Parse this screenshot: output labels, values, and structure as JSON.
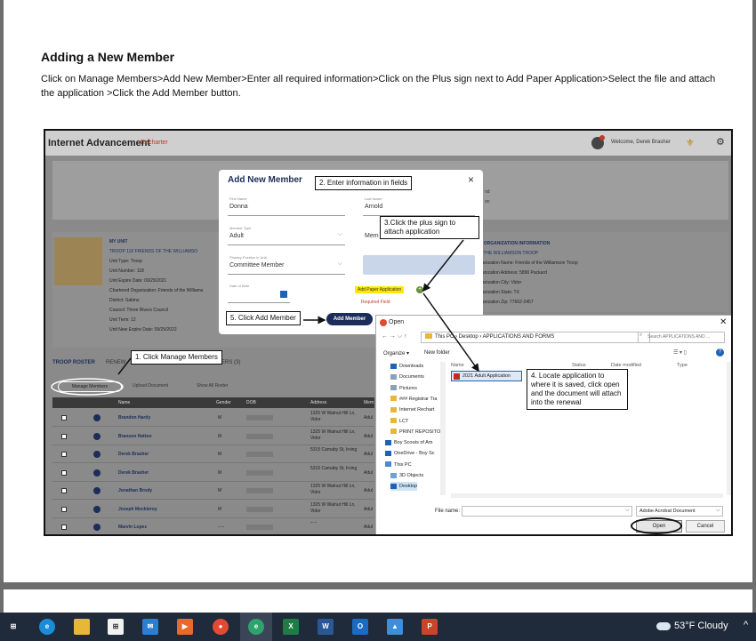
{
  "document": {
    "heading": "Adding a New Member",
    "instructions": "Click on Manage Members>Add New Member>Enter all required information>Click on the Plus sign next to Add Paper Application>Select the file and attach the application >Click the Add Member button."
  },
  "app": {
    "title": "Internet Advancement",
    "mode": "Recharter",
    "welcome": "Welcome, Derek Brasher",
    "banner_text_fragments": [
      "nd",
      "on"
    ],
    "unit": {
      "heading": "MY UNIT",
      "name": "TROOP 118 FRIENDS OF THE WILLIAMSO",
      "lines": [
        "Unit Type: Troop",
        "Unit Number: 118",
        "Unit Expire Date: 09/29/2021",
        "Chartered Organization: Friends of the Williams",
        "District: Sabine",
        "Council: Three Rivers Council",
        "Unit Term: 12",
        "Unit New Expire Date: 09/29/2022"
      ]
    },
    "org": {
      "heading": "E ORGANIZATION INFORMATION",
      "name": "F THE WILLIAMSON TROOP",
      "lines": [
        "ganization Name: Friends of the Williamson Troop",
        "ganization Address: 5890 Packard",
        "ganization City: Vidor",
        "ganization State: TX",
        "ganization Zip: 77662-2457"
      ]
    },
    "tabs": [
      "TROOP ROSTER",
      "RENEW",
      "ERS (3)"
    ],
    "actions": {
      "manage": "Manage Members",
      "upload": "Upload Document",
      "show_all": "Show All Roster"
    },
    "roster_columns": [
      "Name",
      "Gender",
      "DOB",
      "Address",
      "Mem"
    ],
    "roster": [
      {
        "name": "Brandon Hardy",
        "gender": "M",
        "address": "1325 W Walnut Hill Ln, Vidor",
        "type": "Adul"
      },
      {
        "name": "Branson Hatton",
        "gender": "M",
        "address": "1325 W Walnut Hill Ln, Vidor",
        "type": "Adul"
      },
      {
        "name": "Derek Brasher",
        "gender": "M",
        "address": "5315 Camaby St, Irving",
        "type": "Adul"
      },
      {
        "name": "Derek Brasher",
        "gender": "M",
        "address": "5315 Camaby St, Irving",
        "type": "Adul"
      },
      {
        "name": "Jonathan Brody",
        "gender": "M",
        "address": "1325 W Walnut Hill Ln, Vidor",
        "type": "Adul"
      },
      {
        "name": "Joseph Mockleroy",
        "gender": "M",
        "address": "1325 W Walnut Hill Ln, Vidor",
        "type": "Adul"
      },
      {
        "name": "Marvin Lopez",
        "gender": "– –",
        "address": "– –",
        "type": "Adul"
      }
    ]
  },
  "modal": {
    "title": "Add New Member",
    "close": "×",
    "first_name_label": "First Name",
    "first_name": "Donna",
    "last_name_label": "Last Name",
    "last_name": "Arnold",
    "member_type_label": "Member Type",
    "member_type": "Adult",
    "member_label_partial": "Mem",
    "position_label": "Primary Position in Unit",
    "position": "Committee Member",
    "dob_label": "Date of Birth",
    "paper_app": "Add Paper Application",
    "required": "Required Field",
    "add_button": "Add Member"
  },
  "callouts": {
    "c1": "1. Click Manage Members",
    "c2": "2. Enter information in fields",
    "c3": "3.Click the plus sign to attach application",
    "c4": "4. Locate application to where it is saved, click open and the document will attach into the renewal",
    "c5": "5. Click Add Member"
  },
  "open_dialog": {
    "title": "Open",
    "path": "This PC  ›  Desktop  ›  APPLICATIONS AND FORMS",
    "search_placeholder": "Search APPLICATIONS AND ...",
    "organize": "Organize ▾",
    "new_folder": "New folder",
    "nav_items": [
      "Downloads",
      "Documents",
      "Pictures",
      "### Registrar Tra",
      "Internet Rechart",
      "LCT",
      "PRINT REPOSITO",
      "Boy Scouts of Am",
      "OneDrive - Boy Sc",
      "This PC",
      "3D Objects",
      "Desktop"
    ],
    "columns": [
      "Name",
      "Status",
      "Date modified",
      "Type"
    ],
    "file": "2021 Adult Application",
    "file_name_label": "File name:",
    "file_type": "Adobe Acrobat Document",
    "open_button": "Open",
    "cancel_button": "Cancel"
  },
  "taskbar": {
    "weather": "53°F  Cloudy",
    "apps": [
      "task-view",
      "edge",
      "file-explorer",
      "store",
      "mail",
      "media",
      "chrome",
      "edge-dev",
      "excel",
      "word",
      "outlook",
      "photos",
      "powerpoint"
    ]
  }
}
